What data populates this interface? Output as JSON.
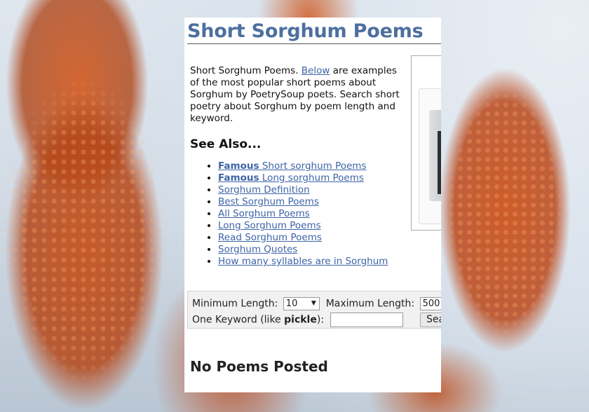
{
  "page": {
    "title": "Short Sorghum Poems",
    "intro_prefix": "Short Sorghum Poems. ",
    "intro_link": "Below",
    "intro_suffix": " are examples of the most popular short poems about Sorghum by PoetrySoup poets. Search short poetry about Sorghum by poem length and keyword.",
    "see_also_heading": "See Also...",
    "links": [
      {
        "bold": "Famous",
        "text": " Short sorghum Poems"
      },
      {
        "bold": "Famous",
        "text": " Long sorghum Poems"
      },
      {
        "bold": "",
        "text": "Sorghum Definition"
      },
      {
        "bold": "",
        "text": "Best Sorghum Poems"
      },
      {
        "bold": "",
        "text": "All Sorghum Poems"
      },
      {
        "bold": "",
        "text": "Long Sorghum Poems"
      },
      {
        "bold": "",
        "text": "Read Sorghum Poems"
      },
      {
        "bold": "",
        "text": "Sorghum Quotes"
      },
      {
        "bold": "",
        "text": "How many syllables are in Sorghum"
      }
    ],
    "search": {
      "min_label": "Minimum Length:",
      "min_value": "10",
      "max_label": "Maximum Length:",
      "max_value": "500",
      "keyword_label_prefix": "One Keyword (like ",
      "keyword_example": "pickle",
      "keyword_label_suffix": "):",
      "keyword_value": "",
      "search_button": "Search"
    },
    "empty_state": "No Poems Posted"
  },
  "colors": {
    "title": "#4d6fa0",
    "link": "#3e64a8",
    "form_bg": "#f1f1f1"
  },
  "icons": {
    "dropdown": "chevron-down-icon",
    "ad_image": "printer-image"
  }
}
